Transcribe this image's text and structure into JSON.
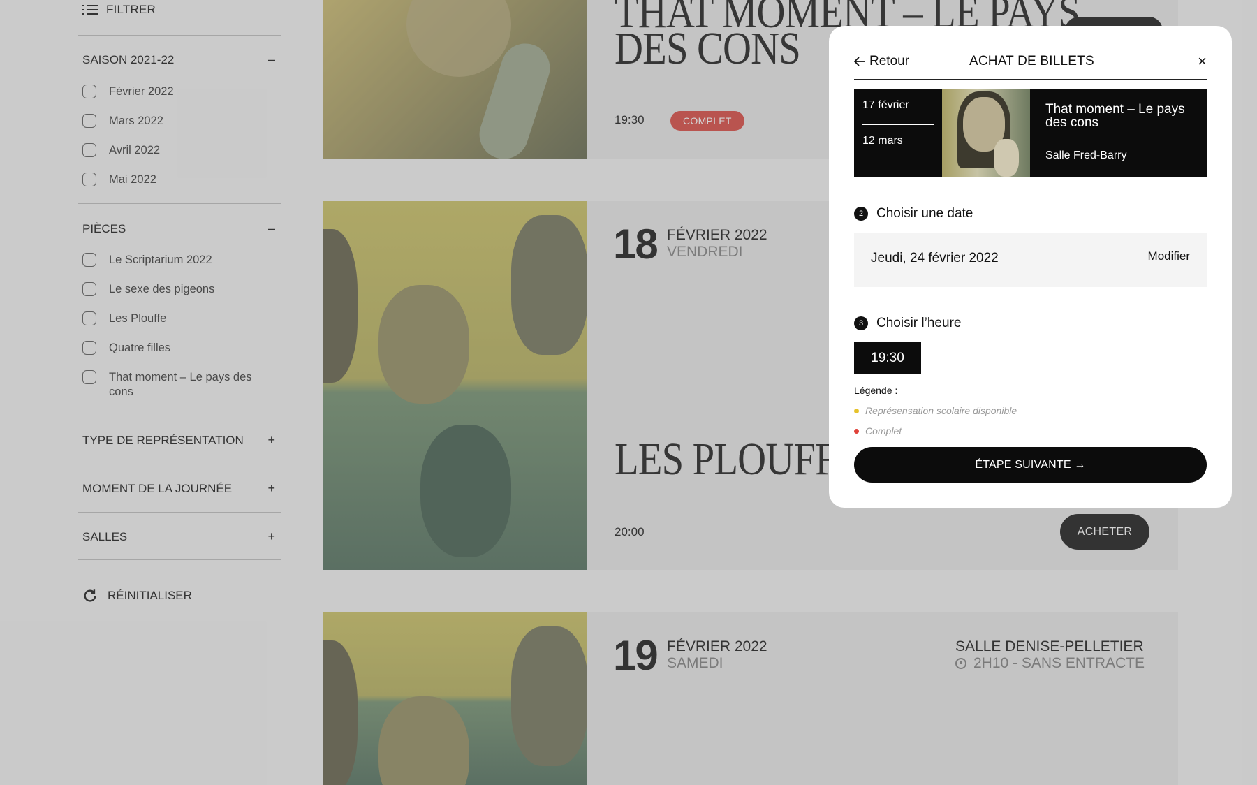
{
  "sidebar": {
    "filter_label": "FILTRER",
    "season": {
      "title": "SAISON 2021-22",
      "toggle": "–",
      "items": [
        "Février 2022",
        "Mars 2022",
        "Avril 2022",
        "Mai 2022"
      ]
    },
    "pieces": {
      "title": "PIÈCES",
      "toggle": "–",
      "items": [
        "Le Scriptarium 2022",
        "Le sexe des pigeons",
        "Les Plouffe",
        "Quatre filles",
        "That moment – Le pays des cons"
      ]
    },
    "type": {
      "title": "TYPE DE REPRÉSENTATION",
      "toggle": "+"
    },
    "moment": {
      "title": "MOMENT DE LA JOURNÉE",
      "toggle": "+"
    },
    "salles": {
      "title": "SALLES",
      "toggle": "+"
    },
    "reset_label": "RÉINITIALISER"
  },
  "events": {
    "first": {
      "title_line1": "THAT MOMENT – LE PAYS",
      "title_line2": "DES CONS",
      "time": "19:30",
      "status": "COMPLET"
    },
    "second": {
      "day": "18",
      "month": "FÉVRIER 2022",
      "weekday": "VENDREDI",
      "title": "LES PLOUFFE",
      "time": "20:00",
      "buy_label": "ACHETER"
    },
    "third": {
      "day": "19",
      "month": "FÉVRIER 2022",
      "weekday": "SAMEDI",
      "venue": "SALLE DENISE-PELLETIER",
      "duration": "2H10 - SANS ENTRACTE"
    }
  },
  "modal": {
    "back_label": "Retour",
    "title": "ACHAT DE BILLETS",
    "close_glyph": "×",
    "show": {
      "date_start": "17 février",
      "date_end": "12 mars",
      "name": "That moment – Le pays des cons",
      "venue": "Salle Fred-Barry"
    },
    "step2": {
      "number": "2",
      "label": "Choisir une date"
    },
    "selected_date": "Jeudi, 24 février 2022",
    "modify_label": "Modifier",
    "step3": {
      "number": "3",
      "label": "Choisir l’heure"
    },
    "time_option": "19:30",
    "legend": {
      "label": "Légende :",
      "items": [
        {
          "text": "Représensation scolaire disponible",
          "color": "#e6c22b"
        },
        {
          "text": "Complet",
          "color": "#e0423a"
        }
      ]
    },
    "next_label": "ÉTAPE SUIVANTE →"
  },
  "colors": {
    "complet": "#d9423b",
    "primary": "#111111",
    "overlay": "rgba(120,120,120,0.33)"
  }
}
